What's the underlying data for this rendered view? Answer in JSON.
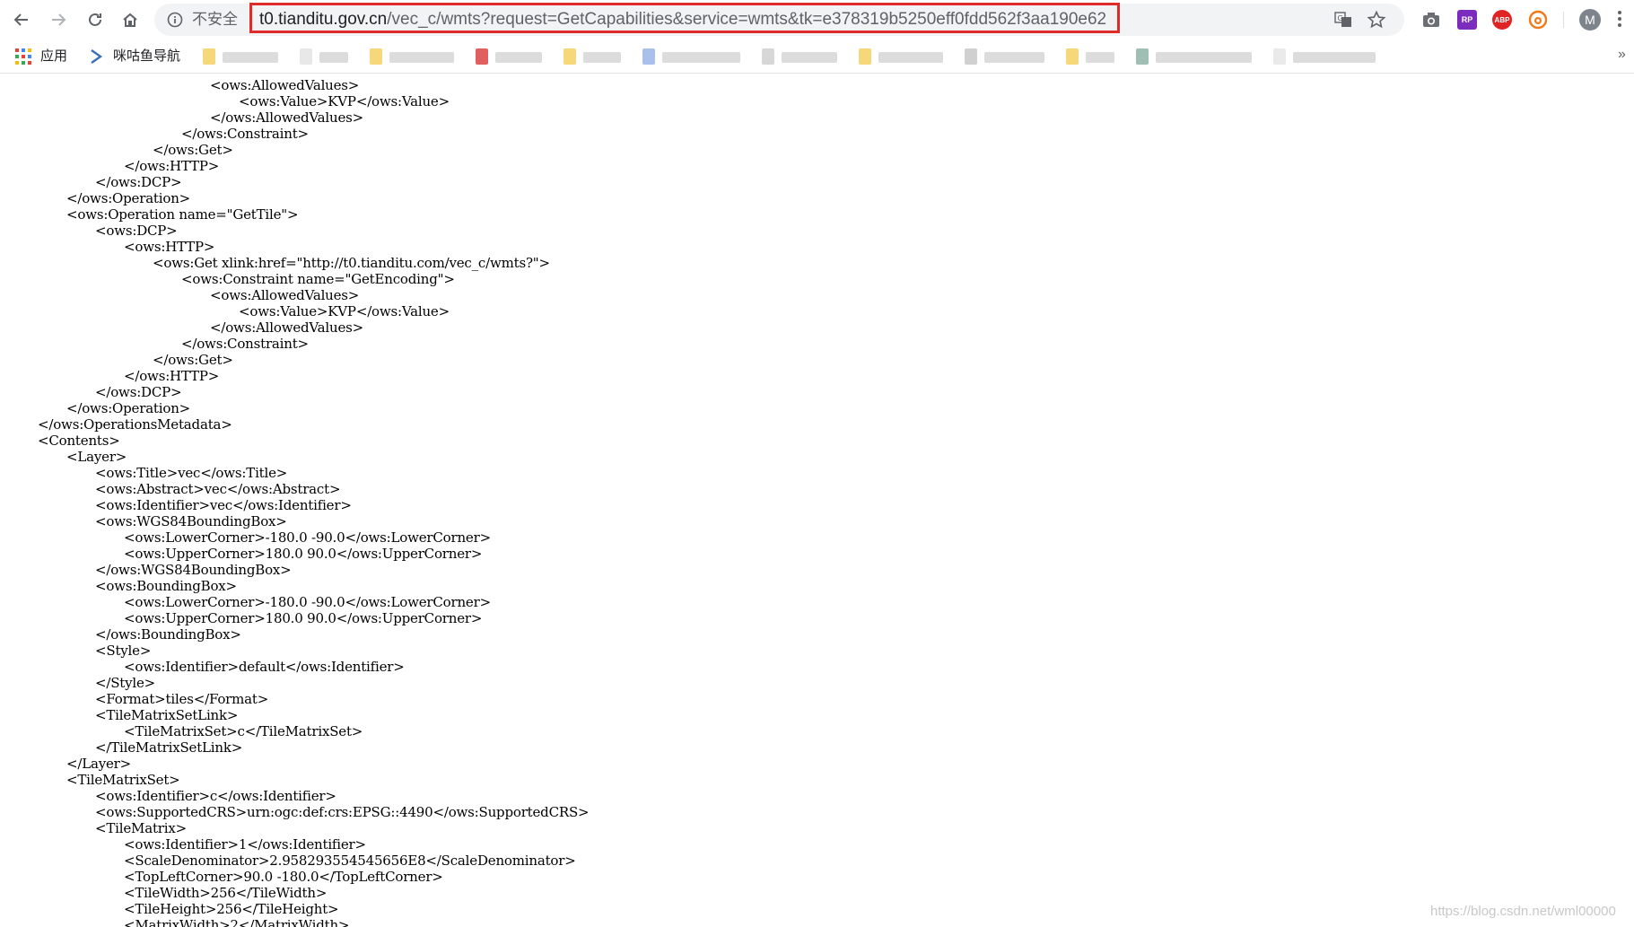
{
  "toolbar": {
    "insecure_label": "不安全",
    "url_host": "t0.tianditu.gov.cn",
    "url_path": "/vec_c/wmts?request=GetCapabilities&service=wmts&tk=e378319b5250eff0fdd562f3aa190e62",
    "avatar_letter": "M",
    "extensions": [
      "camera-icon",
      "rp-extension-icon",
      "abp-extension-icon",
      "weibo-extension-icon"
    ],
    "rp_label": "RP",
    "abp_label": "ABP",
    "highlight_color": "#e02b2b"
  },
  "bookmarks": {
    "apps_label": "应用",
    "nav_label": "咪咕鱼导航",
    "more": "»"
  },
  "xml_lines": [
    {
      "indent": 6,
      "text": "<ows:AllowedValues>"
    },
    {
      "indent": 7,
      "text": "<ows:Value>KVP</ows:Value>"
    },
    {
      "indent": 6,
      "text": "</ows:AllowedValues>"
    },
    {
      "indent": 5,
      "text": "</ows:Constraint>"
    },
    {
      "indent": 4,
      "text": "</ows:Get>"
    },
    {
      "indent": 3,
      "text": "</ows:HTTP>"
    },
    {
      "indent": 2,
      "text": "</ows:DCP>"
    },
    {
      "indent": 1,
      "text": "</ows:Operation>"
    },
    {
      "indent": 1,
      "text": "<ows:Operation name=\"GetTile\">"
    },
    {
      "indent": 2,
      "text": "<ows:DCP>"
    },
    {
      "indent": 3,
      "text": "<ows:HTTP>"
    },
    {
      "indent": 4,
      "text": "<ows:Get xlink:href=\"http://t0.tianditu.com/vec_c/wmts?\">"
    },
    {
      "indent": 5,
      "text": "<ows:Constraint name=\"GetEncoding\">"
    },
    {
      "indent": 6,
      "text": "<ows:AllowedValues>"
    },
    {
      "indent": 7,
      "text": "<ows:Value>KVP</ows:Value>"
    },
    {
      "indent": 6,
      "text": "</ows:AllowedValues>"
    },
    {
      "indent": 5,
      "text": "</ows:Constraint>"
    },
    {
      "indent": 4,
      "text": "</ows:Get>"
    },
    {
      "indent": 3,
      "text": "</ows:HTTP>"
    },
    {
      "indent": 2,
      "text": "</ows:DCP>"
    },
    {
      "indent": 1,
      "text": "</ows:Operation>"
    },
    {
      "indent": 0,
      "text": "</ows:OperationsMetadata>"
    },
    {
      "indent": 0,
      "text": "<Contents>"
    },
    {
      "indent": 1,
      "text": "<Layer>"
    },
    {
      "indent": 2,
      "text": "<ows:Title>vec</ows:Title>"
    },
    {
      "indent": 2,
      "text": "<ows:Abstract>vec</ows:Abstract>"
    },
    {
      "indent": 2,
      "text": "<ows:Identifier>vec</ows:Identifier>"
    },
    {
      "indent": 2,
      "text": "<ows:WGS84BoundingBox>"
    },
    {
      "indent": 3,
      "text": "<ows:LowerCorner>-180.0 -90.0</ows:LowerCorner>"
    },
    {
      "indent": 3,
      "text": "<ows:UpperCorner>180.0 90.0</ows:UpperCorner>"
    },
    {
      "indent": 2,
      "text": "</ows:WGS84BoundingBox>"
    },
    {
      "indent": 2,
      "text": "<ows:BoundingBox>"
    },
    {
      "indent": 3,
      "text": "<ows:LowerCorner>-180.0 -90.0</ows:LowerCorner>"
    },
    {
      "indent": 3,
      "text": "<ows:UpperCorner>180.0 90.0</ows:UpperCorner>"
    },
    {
      "indent": 2,
      "text": "</ows:BoundingBox>"
    },
    {
      "indent": 2,
      "text": "<Style>"
    },
    {
      "indent": 3,
      "text": "<ows:Identifier>default</ows:Identifier>"
    },
    {
      "indent": 2,
      "text": "</Style>"
    },
    {
      "indent": 2,
      "text": "<Format>tiles</Format>"
    },
    {
      "indent": 2,
      "text": "<TileMatrixSetLink>"
    },
    {
      "indent": 3,
      "text": "<TileMatrixSet>c</TileMatrixSet>"
    },
    {
      "indent": 2,
      "text": "</TileMatrixSetLink>"
    },
    {
      "indent": 1,
      "text": "</Layer>"
    },
    {
      "indent": 1,
      "text": "<TileMatrixSet>"
    },
    {
      "indent": 2,
      "text": "<ows:Identifier>c</ows:Identifier>"
    },
    {
      "indent": 2,
      "text": "<ows:SupportedCRS>urn:ogc:def:crs:EPSG::4490</ows:SupportedCRS>"
    },
    {
      "indent": 2,
      "text": "<TileMatrix>"
    },
    {
      "indent": 3,
      "text": "<ows:Identifier>1</ows:Identifier>"
    },
    {
      "indent": 3,
      "text": "<ScaleDenominator>2.958293554545656E8</ScaleDenominator>"
    },
    {
      "indent": 3,
      "text": "<TopLeftCorner>90.0 -180.0</TopLeftCorner>"
    },
    {
      "indent": 3,
      "text": "<TileWidth>256</TileWidth>"
    },
    {
      "indent": 3,
      "text": "<TileHeight>256</TileHeight>"
    },
    {
      "indent": 3,
      "text": "<MatrixWidth>2</MatrixWidth>"
    }
  ],
  "watermark": "https://blog.csdn.net/wml00000"
}
